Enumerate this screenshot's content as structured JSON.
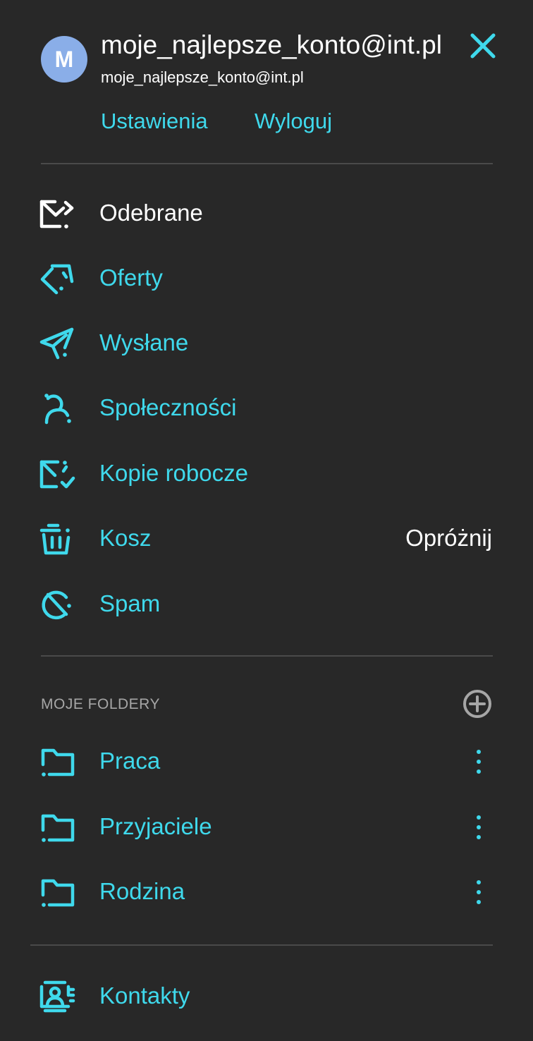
{
  "account": {
    "avatar_letter": "M",
    "name": "moje_najlepsze_konto@int.pl",
    "email": "moje_najlepsze_konto@int.pl",
    "settings_label": "Ustawienia",
    "logout_label": "Wyloguj"
  },
  "nav": {
    "items": [
      {
        "label": "Odebrane",
        "icon": "inbox-icon",
        "active": true
      },
      {
        "label": "Oferty",
        "icon": "tag-icon"
      },
      {
        "label": "Wysłane",
        "icon": "paper-plane-icon"
      },
      {
        "label": "Społeczności",
        "icon": "community-icon"
      },
      {
        "label": "Kopie robocze",
        "icon": "draft-icon"
      },
      {
        "label": "Kosz",
        "icon": "trash-icon",
        "action": "Opróżnij"
      },
      {
        "label": "Spam",
        "icon": "spam-icon"
      }
    ]
  },
  "folders": {
    "title": "MOJE FOLDERY",
    "items": [
      {
        "label": "Praca",
        "icon": "folder-icon"
      },
      {
        "label": "Przyjaciele",
        "icon": "folder-icon"
      },
      {
        "label": "Rodzina",
        "icon": "folder-icon"
      }
    ]
  },
  "contacts": {
    "label": "Kontakty",
    "icon": "contacts-icon"
  },
  "colors": {
    "background": "#282828",
    "accent": "#3fd9ec",
    "avatar": "#8aaee8",
    "divider": "#4a4a4a",
    "muted": "#a6a6a6"
  }
}
